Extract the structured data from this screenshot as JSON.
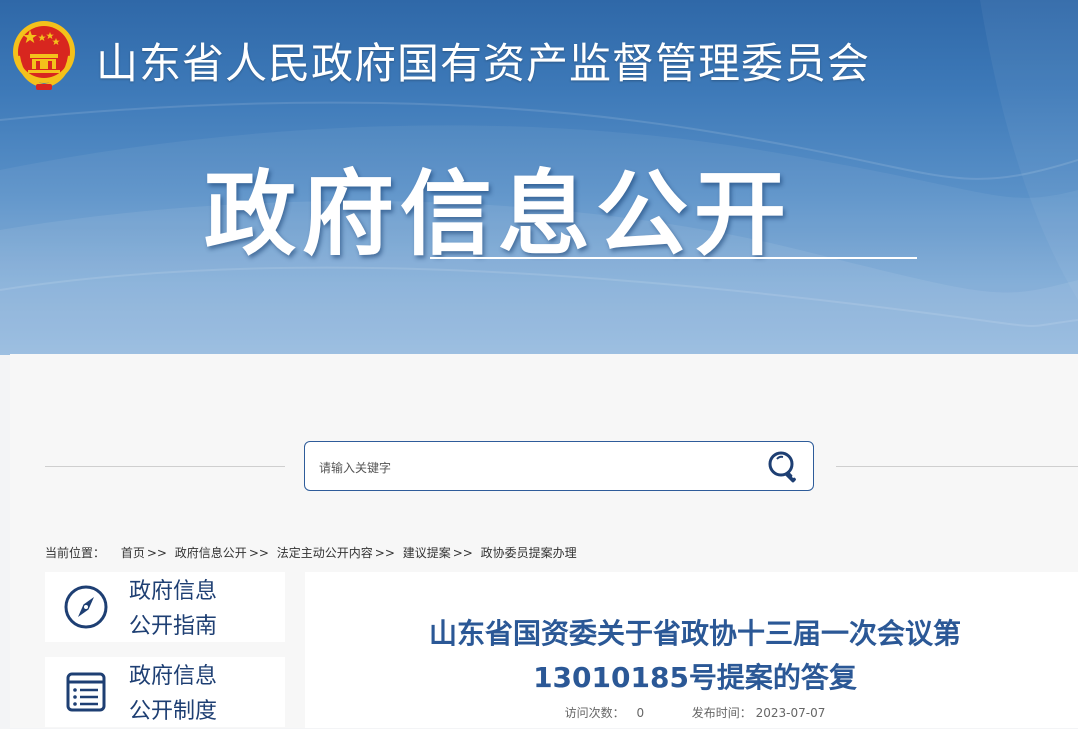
{
  "header": {
    "site_name": "山东省人民政府国有资产监督管理委员会",
    "section_title": "政府信息公开"
  },
  "search": {
    "placeholder": "请输入关键字",
    "value": ""
  },
  "breadcrumb": {
    "prefix": "当前位置：",
    "items": [
      "首页",
      "政府信息公开",
      "法定主动公开内容",
      "建议提案",
      "政协委员提案办理"
    ],
    "separator": ">>"
  },
  "sidebar": {
    "items": [
      {
        "line1": "政府信息",
        "line2": "公开指南",
        "icon": "compass-icon"
      },
      {
        "line1": "政府信息",
        "line2": "公开制度",
        "icon": "document-list-icon"
      }
    ]
  },
  "article": {
    "title_line1": "山东省国资委关于省政协十三届一次会议第",
    "title_line2": "13010185号提案的答复",
    "views_label": "访问次数：",
    "views_value": "0",
    "date_label": "发布时间：",
    "date_value": "2023-07-07"
  },
  "colors": {
    "banner_top": "#2f68a8",
    "banner_bottom": "#8fb6dd",
    "accent_blue": "#2b5896",
    "sidebar_text": "#1e3f73",
    "emblem_red": "#d8261f",
    "emblem_gold": "#f4c11b"
  }
}
